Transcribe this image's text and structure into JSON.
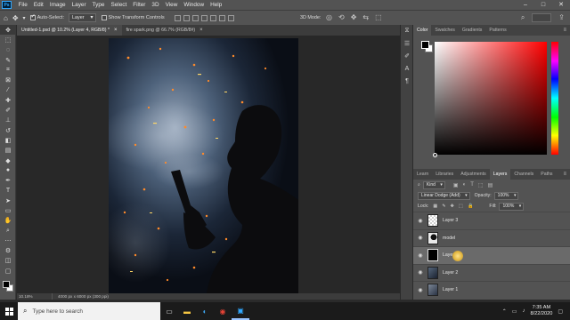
{
  "app": {
    "logo": "Ps"
  },
  "menubar": {
    "items": [
      "File",
      "Edit",
      "Image",
      "Layer",
      "Type",
      "Select",
      "Filter",
      "3D",
      "View",
      "Window",
      "Help"
    ],
    "window_controls": [
      "–",
      "□",
      "✕"
    ]
  },
  "options_bar": {
    "auto_select_label": "Auto-Select:",
    "auto_select_checked": true,
    "auto_select_target": "Layer",
    "show_transform_label": "Show Transform Controls",
    "show_transform_checked": false,
    "mode_3d_label": "3D Mode:"
  },
  "document_tabs": [
    {
      "label": "Untitled-1.psd @ 10.2% (Layer 4, RGB/8) *",
      "active": true
    },
    {
      "label": "fire spark.png @ 66.7% (RGB/8#)",
      "active": false
    }
  ],
  "status": {
    "zoom": "10.18%",
    "doc_info": "4000 px x 6000 px (300 ppi)"
  },
  "color_panel": {
    "tabs": [
      "Color",
      "Swatches",
      "Gradients",
      "Patterns"
    ],
    "active_tab": "Color",
    "foreground": "#000000",
    "background": "#ffffff",
    "hue": "#ff0000"
  },
  "layers_panel": {
    "tabs": [
      "Learn",
      "Libraries",
      "Adjustments",
      "Layers",
      "Channels",
      "Paths"
    ],
    "active_tab": "Layers",
    "filter_kind": "Kind",
    "blend_mode": "Linear Dodge (Add)",
    "opacity_label": "Opacity:",
    "opacity_value": "100%",
    "lock_label": "Lock:",
    "fill_label": "Fill:",
    "fill_value": "100%",
    "layers": [
      {
        "name": "Layer 3",
        "visible": true,
        "active": false,
        "thumb": "transparent"
      },
      {
        "name": "model",
        "visible": true,
        "active": false,
        "thumb": "portrait"
      },
      {
        "name": "Layer 4",
        "visible": true,
        "active": true,
        "thumb": "black"
      },
      {
        "name": "Layer 2",
        "visible": true,
        "active": false,
        "thumb": "texture"
      },
      {
        "name": "Layer 1",
        "visible": true,
        "active": false,
        "thumb": "texture"
      }
    ]
  },
  "taskbar": {
    "search_placeholder": "Type here to search",
    "time": "7:35 AM",
    "date": "8/22/2020"
  },
  "accent_colors": {
    "ps_blue": "#31a8ff",
    "panel_bg": "#535353",
    "canvas_bg": "#282828"
  }
}
